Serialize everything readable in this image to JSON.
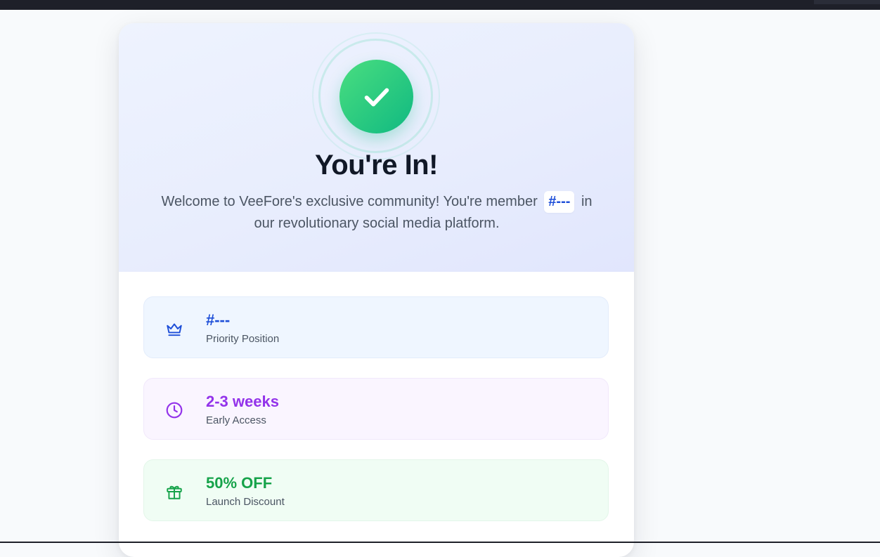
{
  "hero": {
    "title": "You're In!",
    "subtitle_before": "Welcome to VeeFore's exclusive community! You're member",
    "member_number": "#---",
    "subtitle_after": "in our revolutionary social media platform."
  },
  "perks": [
    {
      "icon": "crown-icon",
      "value": "#---",
      "label": "Priority Position",
      "accent": "#1d4ed8"
    },
    {
      "icon": "clock-icon",
      "value": "2-3 weeks",
      "label": "Early Access",
      "accent": "#9333ea"
    },
    {
      "icon": "gift-icon",
      "value": "50% OFF",
      "label": "Launch Discount",
      "accent": "#16a34a"
    }
  ],
  "colors": {
    "success_green": "#10b981",
    "hero_background": "#e8edfd",
    "page_background": "#f8fafc"
  }
}
